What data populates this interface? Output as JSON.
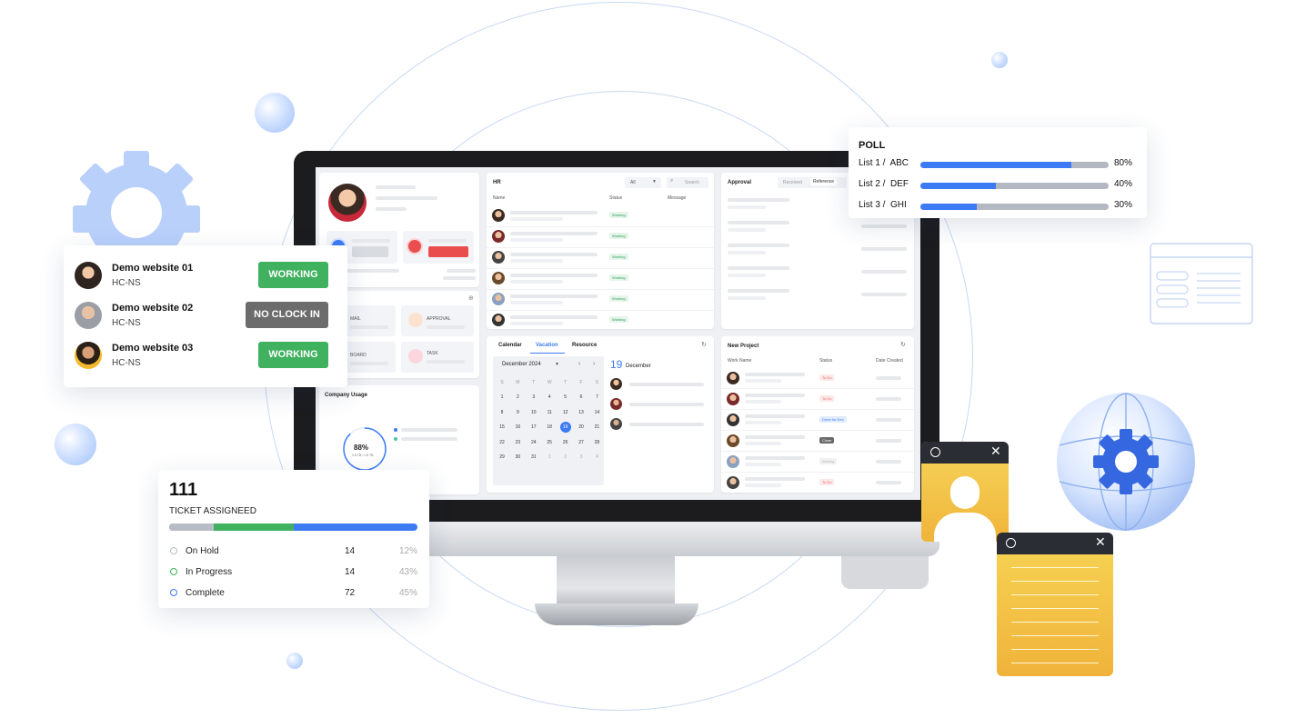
{
  "status_list": {
    "items": [
      {
        "title": "Demo website 01",
        "subtitle": "HC-NS",
        "status": "WORKING",
        "color": "#3fb15f"
      },
      {
        "title": "Demo website 02",
        "subtitle": "HC-NS",
        "status": "NO CLOCK IN",
        "color": "#6c6c6c"
      },
      {
        "title": "Demo website 03",
        "subtitle": "HC-NS",
        "status": "WORKING",
        "color": "#3fb15f"
      }
    ]
  },
  "poll": {
    "title": "POLL",
    "items": [
      {
        "label": "List 1 /  ABC",
        "value": 80,
        "pct": "80%"
      },
      {
        "label": "List 2 /  DEF",
        "value": 40,
        "pct": "40%"
      },
      {
        "label": "List 3 /  GHI",
        "value": 30,
        "pct": "30%"
      }
    ]
  },
  "tickets": {
    "total": "111",
    "label": "TICKET ASSIGNEED",
    "rows": [
      {
        "name": "On Hold",
        "count": "14",
        "pct": "12%",
        "color": "#b8bcc4"
      },
      {
        "name": "In Progress",
        "count": "14",
        "pct": "43%",
        "color": "#3fb15f"
      },
      {
        "name": "Complete",
        "count": "72",
        "pct": "45%",
        "color": "#3d7bf4"
      }
    ]
  },
  "dashboard": {
    "profile": {
      "mail": "MAIL",
      "approval": "APPROVAL",
      "board": "BOARD",
      "task": "TASK"
    },
    "usage": {
      "title": "Company Usage",
      "percent": "88%",
      "sub": "1.6 TB / 1.8 TB"
    },
    "hr": {
      "title": "HR",
      "filter": "All",
      "search_placeholder": "Search",
      "columns": [
        "Name",
        "Status",
        "Message"
      ],
      "statuses": [
        "Working",
        "Working",
        "Working",
        "Working",
        "Working",
        "Working"
      ]
    },
    "approval": {
      "title": "Approval",
      "tabs": [
        "Received",
        "Reference"
      ]
    },
    "calendar": {
      "tabs": [
        "Calendar",
        "Vacation",
        "Resource"
      ],
      "month": "December 2024",
      "weekdays": [
        "S",
        "M",
        "T",
        "W",
        "T",
        "F",
        "S"
      ],
      "weeks": [
        [
          "1",
          "2",
          "3",
          "4",
          "5",
          "6",
          "7"
        ],
        [
          "8",
          "9",
          "10",
          "11",
          "12",
          "13",
          "14"
        ],
        [
          "15",
          "16",
          "17",
          "18",
          "19",
          "20",
          "21"
        ],
        [
          "22",
          "23",
          "24",
          "25",
          "26",
          "27",
          "28"
        ],
        [
          "29",
          "30",
          "31",
          "1",
          "2",
          "3",
          "4"
        ]
      ],
      "selected": "19",
      "day_number": "19",
      "day_month": "December"
    },
    "project": {
      "title": "New Project",
      "columns": [
        "Work Name",
        "Status",
        "Date Created"
      ],
      "statuses": [
        "To Do",
        "To Do",
        "Done for Dev",
        "Close",
        "Waiting",
        "To Do"
      ]
    }
  },
  "colors": {
    "accent": "#3d7bf4",
    "green": "#3fb15f",
    "gray_btn": "#6c6c6c",
    "sticky_yellow": "#f4c94a"
  }
}
